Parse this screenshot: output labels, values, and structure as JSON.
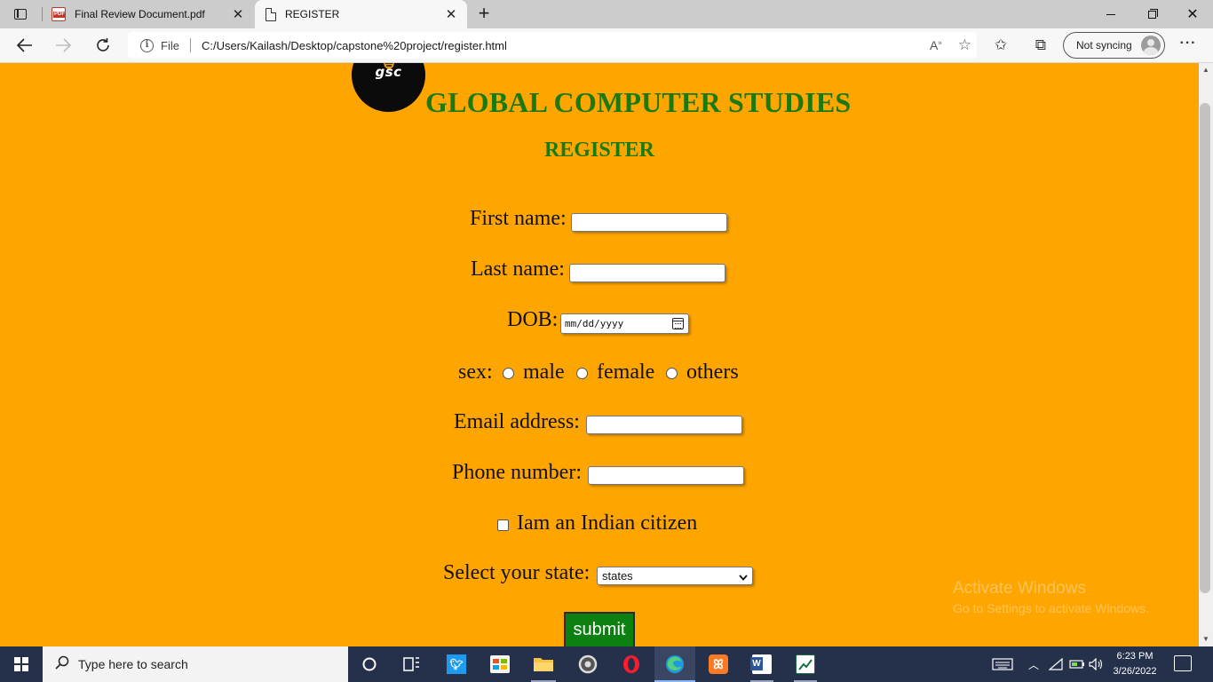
{
  "browser": {
    "tabs": [
      {
        "title": "Final Review Document.pdf",
        "icon": "pdf-icon",
        "active": false
      },
      {
        "title": "REGISTER",
        "icon": "page-icon",
        "active": true
      }
    ],
    "address": {
      "file_label": "File",
      "url": "C:/Users/Kailash/Desktop/capstone%20project/register.html"
    },
    "sync_label": "Not syncing"
  },
  "page": {
    "logo_text": "gsc",
    "site_title": "GLOBAL COMPUTER STUDIES",
    "heading": "REGISTER",
    "form": {
      "first_name_label": "First name:",
      "first_name_value": "",
      "last_name_label": "Last name:",
      "last_name_value": "",
      "dob_label": "DOB:",
      "dob_placeholder": "mm/dd/yyyy",
      "sex_label": "sex:",
      "sex_options": [
        "male",
        "female",
        "others"
      ],
      "email_label": "Email address:",
      "email_value": "",
      "phone_label": "Phone number:",
      "phone_value": "",
      "citizen_label": "Iam an Indian citizen",
      "citizen_checked": false,
      "state_label": "Select your state:",
      "state_selected": "states",
      "submit_label": "submit"
    },
    "watermark": {
      "line1": "Activate Windows",
      "line2": "Go to Settings to activate Windows."
    },
    "colors": {
      "background": "#ffa500",
      "title": "#1a7a10",
      "submit_bg": "#0d8012"
    }
  },
  "taskbar": {
    "search_placeholder": "Type here to search",
    "time": "6:23 PM",
    "date": "3/26/2022"
  }
}
